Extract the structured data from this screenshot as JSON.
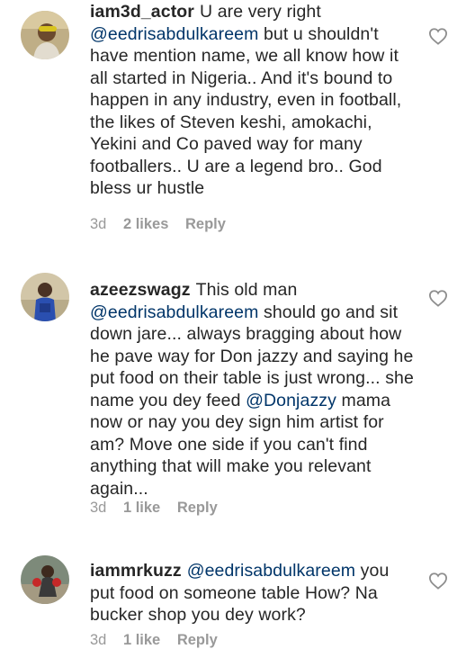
{
  "comments": [
    {
      "username": "iam3d_actor",
      "text_1": "U are very right ",
      "mention_1": "@eedrisabdulkareem",
      "text_2": " but u shouldn't have mention name,  we all know how it all started in Nigeria.. And it's bound to happen in any industry,  even in football,  the likes of Steven keshi, amokachi,  Yekini and Co paved way for many footballers.. U are a legend bro.. God bless ur hustle",
      "time": "3d",
      "likes": "2 likes",
      "reply": "Reply",
      "avatar_icon": "user-avatar-icon"
    },
    {
      "username": "azeezswagz",
      "text_1": "This old man ",
      "mention_1": "@eedrisabdulkareem",
      "text_2": " should go and sit down jare... always bragging about how he pave way for Don jazzy and saying he put food on their table is just wrong... she name you dey feed ",
      "mention_2": "@Donjazzy",
      "text_3": " mama now or nay you dey sign him artist for am? Move one side if you can't find anything that will make you relevant again...",
      "time": "3d",
      "likes": "1 like",
      "reply": "Reply",
      "avatar_icon": "user-avatar-icon"
    },
    {
      "username": "iammrkuzz",
      "text_1": "",
      "mention_1": "@eedrisabdulkareem",
      "text_2": " you put food on someone table How? Na bucker shop you dey work?",
      "time": "3d",
      "likes": "1 like",
      "reply": "Reply",
      "avatar_icon": "user-avatar-icon"
    }
  ],
  "colors": {
    "text": "#262626",
    "mention": "#003569",
    "meta": "#999999",
    "heart": "#8e8e8e"
  },
  "icons": {
    "like": "heart-outline-icon"
  }
}
